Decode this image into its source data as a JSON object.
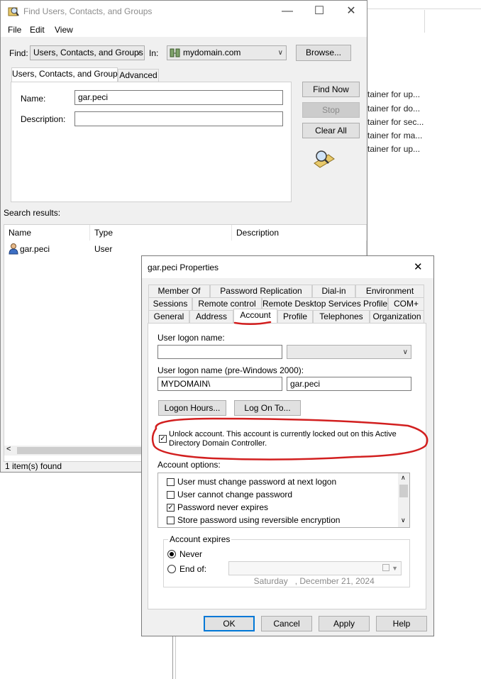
{
  "background": {
    "texts": [
      "tainer for up...",
      "tainer for do...",
      "tainer for sec...",
      "tainer for ma...",
      "tainer for up..."
    ]
  },
  "find_window": {
    "title": "Find Users, Contacts, and Groups",
    "controls": {
      "minimize": "—",
      "maximize": "☐",
      "close": "✕"
    },
    "menu": [
      "File",
      "Edit",
      "View"
    ],
    "find_label": "Find:",
    "find_value": "Users, Contacts, and Groups",
    "in_label": "In:",
    "in_value": "mydomain.com",
    "browse_label": "Browse...",
    "tabs": [
      "Users, Contacts, and Groups",
      "Advanced"
    ],
    "name_label": "Name:",
    "name_value": "gar.peci",
    "description_label": "Description:",
    "description_value": "",
    "buttons": {
      "find_now": "Find Now",
      "stop": "Stop",
      "clear_all": "Clear All"
    },
    "search_results_label": "Search results:",
    "columns": [
      "Name",
      "Type",
      "Description"
    ],
    "rows": [
      {
        "name": "gar.peci",
        "type": "User",
        "description": ""
      }
    ],
    "scroll_left": "<",
    "status": "1 item(s) found"
  },
  "properties": {
    "title": "gar.peci Properties",
    "close": "✕",
    "tabs_row1": [
      "Member Of",
      "Password Replication",
      "Dial-in",
      "Environment"
    ],
    "tabs_row2": [
      "Sessions",
      "Remote control",
      "Remote Desktop Services Profile",
      "COM+"
    ],
    "tabs_row3": [
      "General",
      "Address",
      "Account",
      "Profile",
      "Telephones",
      "Organization"
    ],
    "active_tab": "Account",
    "user_logon_name_label": "User logon name:",
    "user_logon_name_value": "",
    "upn_suffix_value": "",
    "pre2000_label": "User logon name (pre-Windows 2000):",
    "pre2000_domain": "MYDOMAIN\\",
    "pre2000_user": "gar.peci",
    "logon_hours_button": "Logon Hours...",
    "log_on_to_button": "Log On To...",
    "unlock_checked": true,
    "unlock_text_line1": "Unlock account. This account is currently locked out on this Active",
    "unlock_text_line2": "Directory Domain Controller.",
    "account_options_label": "Account options:",
    "account_options": [
      {
        "label": "User must change password at next logon",
        "checked": false
      },
      {
        "label": "User cannot change password",
        "checked": false
      },
      {
        "label": "Password never expires",
        "checked": true
      },
      {
        "label": "Store password using reversible encryption",
        "checked": false
      }
    ],
    "account_expires_label": "Account expires",
    "never_label": "Never",
    "never_selected": true,
    "end_of_label": "End of:",
    "end_of_date": "Saturday   , December 21, 2024",
    "buttons": {
      "ok": "OK",
      "cancel": "Cancel",
      "apply": "Apply",
      "help": "Help"
    }
  },
  "colors": {
    "annotation": "#d21f1f",
    "accent": "#0078d7"
  }
}
